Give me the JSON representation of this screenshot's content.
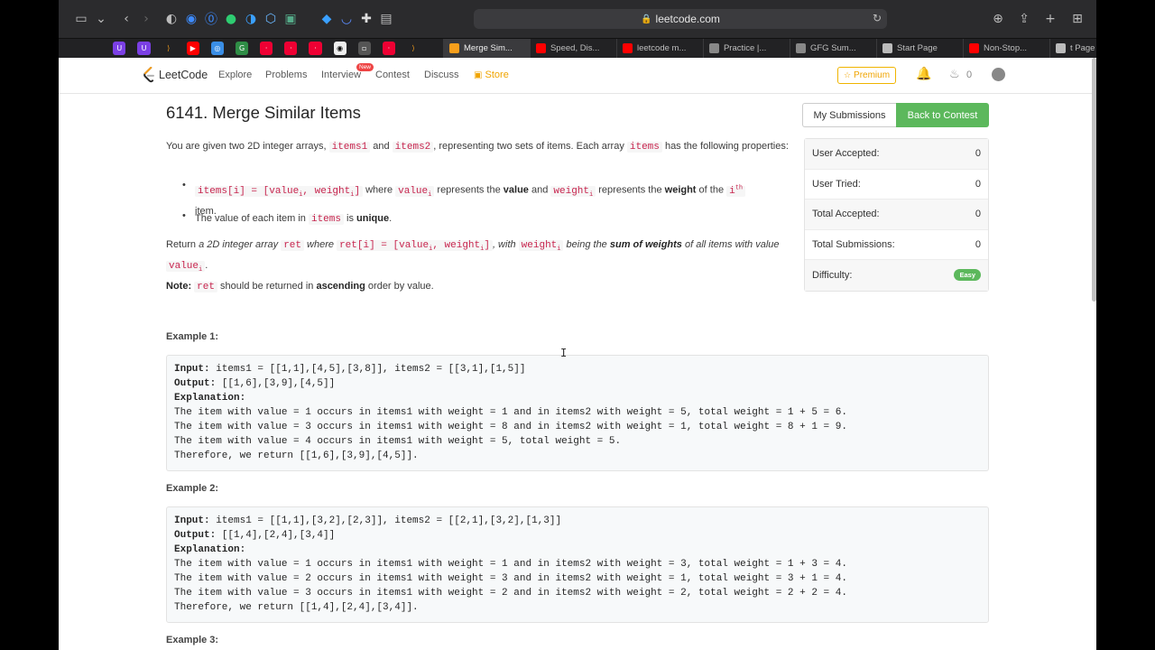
{
  "browser": {
    "url": "leetcode.com",
    "tabs": [
      {
        "label": "Merge Sim...",
        "color": "#f89f1b",
        "active": true
      },
      {
        "label": "Speed, Dis...",
        "color": "#ff0000"
      },
      {
        "label": "leetcode m...",
        "color": "#ff0000"
      },
      {
        "label": "Practice |...",
        "color": "#888888"
      },
      {
        "label": "GFG Sum...",
        "color": "#888888"
      },
      {
        "label": "Start Page",
        "color": "#bbbbbb"
      },
      {
        "label": "Non-Stop...",
        "color": "#ff0000"
      },
      {
        "label": "t Page",
        "color": "#bbbbbb"
      }
    ]
  },
  "nav": {
    "logo": "LeetCode",
    "links": [
      "Explore",
      "Problems",
      "Interview",
      "Contest",
      "Discuss"
    ],
    "new_badge": "New",
    "store": "Store",
    "premium": "Premium",
    "fire_count": "0"
  },
  "problem": {
    "title": "6141. Merge Similar Items",
    "desc1a": "You are given two 2D integer arrays, ",
    "items1": "items1",
    "and": " and ",
    "items2": "items2",
    "desc1b": ", representing two sets of items. Each array ",
    "items": "items",
    "desc1c": " has the following properties:",
    "bullet1_code": "items[i] = [value",
    "bullet1_code2": ", weight",
    "bullet1_code3": "]",
    "sub_i": "i",
    "where": " where ",
    "value_i": "value",
    "represents": " represents the ",
    "value_word": "value",
    "and2": " and ",
    "weight_i": "weight",
    "represents2": " represents the ",
    "weight_word": "weight",
    "of_the": " of the ",
    "i_th": "i",
    "th": "th",
    "item": "item.",
    "bullet2a": "The value of each item in ",
    "is": " is ",
    "unique": "unique",
    "dot": ".",
    "return_a": "Return ",
    "return_b": "a 2D integer array ",
    "ret": "ret",
    "return_c": " where ",
    "ret_code": "ret[i] = [value",
    "ret_code2": ", weight",
    "ret_code3": "]",
    "with": ", with ",
    "weight_code": "weight",
    "being": " being the ",
    "sum_weights": "sum of weights",
    "of_all": " of all items with value ",
    "value_end": "value",
    "note_label": "Note:",
    "note_ret": "ret",
    "note_a": " should be returned in ",
    "ascending": "ascending",
    "note_b": " order by value."
  },
  "examples": [
    {
      "title": "Example 1:",
      "input_label": "Input:",
      "input": " items1 = [[1,1],[4,5],[3,8]], items2 = [[3,1],[1,5]]",
      "output_label": "Output:",
      "output": " [[1,6],[3,9],[4,5]]",
      "explanation_label": "Explanation:",
      "lines": [
        "The item with value = 1 occurs in items1 with weight = 1 and in items2 with weight = 5, total weight = 1 + 5 = 6.",
        "The item with value = 3 occurs in items1 with weight = 8 and in items2 with weight = 1, total weight = 8 + 1 = 9.",
        "The item with value = 4 occurs in items1 with weight = 5, total weight = 5.",
        "Therefore, we return [[1,6],[3,9],[4,5]]."
      ]
    },
    {
      "title": "Example 2:",
      "input_label": "Input:",
      "input": " items1 = [[1,1],[3,2],[2,3]], items2 = [[2,1],[3,2],[1,3]]",
      "output_label": "Output:",
      "output": " [[1,4],[2,4],[3,4]]",
      "explanation_label": "Explanation:",
      "lines": [
        "The item with value = 1 occurs in items1 with weight = 1 and in items2 with weight = 3, total weight = 1 + 3 = 4.",
        "The item with value = 2 occurs in items1 with weight = 3 and in items2 with weight = 1, total weight = 3 + 1 = 4.",
        "The item with value = 3 occurs in items1 with weight = 2 and in items2 with weight = 2, total weight = 2 + 2 = 4.",
        "Therefore, we return [[1,4],[2,4],[3,4]]."
      ]
    },
    {
      "title": "Example 3:"
    }
  ],
  "sidebar": {
    "my_submissions": "My Submissions",
    "back_to_contest": "Back to Contest",
    "stats": [
      {
        "label": "User Accepted:",
        "value": "0"
      },
      {
        "label": "User Tried:",
        "value": "0"
      },
      {
        "label": "Total Accepted:",
        "value": "0"
      },
      {
        "label": "Total Submissions:",
        "value": "0"
      }
    ],
    "difficulty_label": "Difficulty:",
    "difficulty": "Easy"
  }
}
